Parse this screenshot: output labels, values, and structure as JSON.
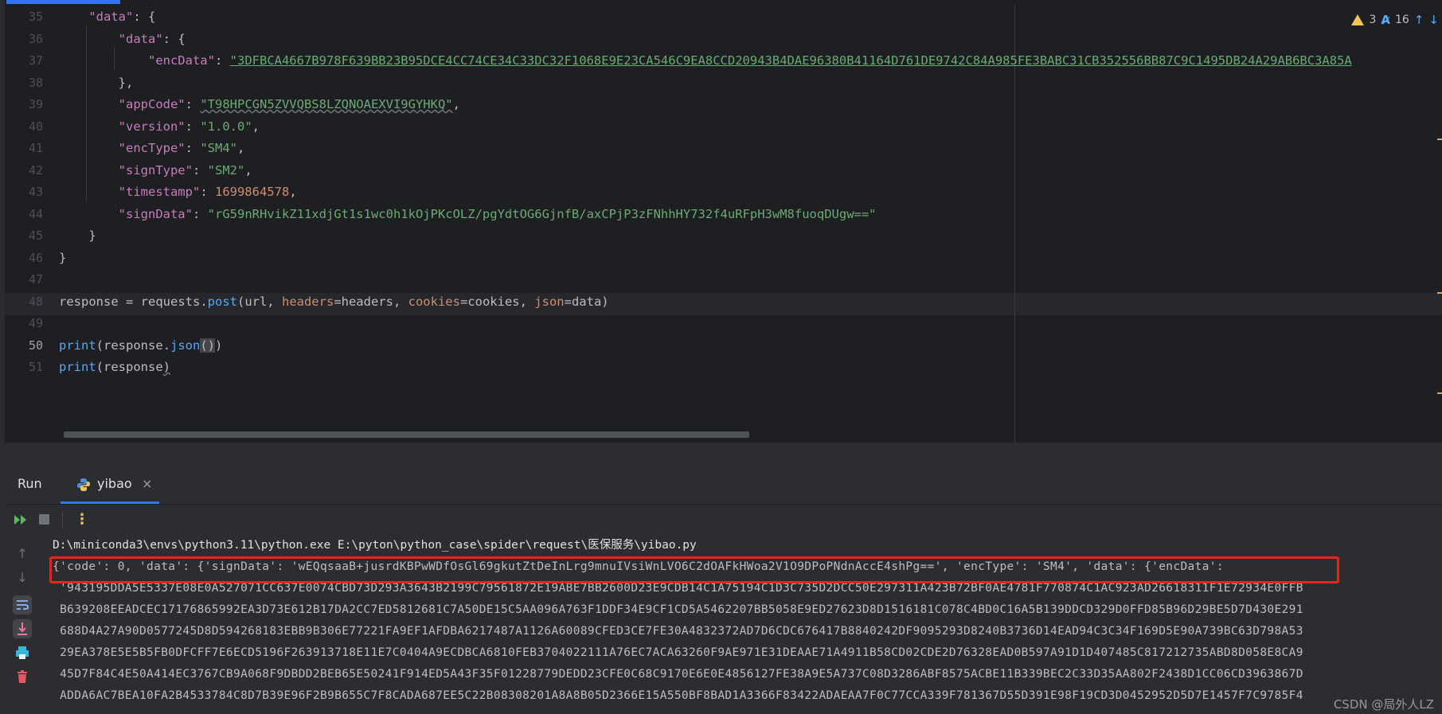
{
  "editor": {
    "line_numbers": [
      "35",
      "36",
      "37",
      "38",
      "39",
      "40",
      "41",
      "42",
      "43",
      "44",
      "45",
      "46",
      "47",
      "48",
      "49",
      "50",
      "51"
    ],
    "current_line": "50",
    "lines": {
      "l35": {
        "indent": "    ",
        "key": "\"data\"",
        "rest": ": {"
      },
      "l36": {
        "indent": "        ",
        "key": "\"data\"",
        "rest": ": {"
      },
      "l37": {
        "indent": "            ",
        "key": "\"encData\"",
        "colon": ": ",
        "value": "\"3DFBCA4667B978F639BB23B95DCE4CC74CE34C33DC32F1068E9E23CA546C9EA8CCD20943B4DAE96380B41164D761DE9742C84A985FE3BABC31CB352556BB87C9C1495DB24A29AB6BC3A85A"
      },
      "l38": {
        "indent": "        ",
        "text": "},"
      },
      "l39": {
        "indent": "        ",
        "key": "\"appCode\"",
        "colon": ": ",
        "value": "\"T98HPCGN5ZVVQBS8LZQNOAEXVI9GYHKQ\"",
        "tail": ","
      },
      "l40": {
        "indent": "        ",
        "key": "\"version\"",
        "colon": ": ",
        "value": "\"1.0.0\"",
        "tail": ","
      },
      "l41": {
        "indent": "        ",
        "key": "\"encType\"",
        "colon": ": ",
        "value": "\"SM4\"",
        "tail": ","
      },
      "l42": {
        "indent": "        ",
        "key": "\"signType\"",
        "colon": ": ",
        "value": "\"SM2\"",
        "tail": ","
      },
      "l43": {
        "indent": "        ",
        "key": "\"timestamp\"",
        "colon": ": ",
        "value": "1699864578",
        "tail": ","
      },
      "l44": {
        "indent": "        ",
        "key": "\"signData\"",
        "colon": ": ",
        "value": "\"rG59nRHvikZ11xdjGt1s1wc0h1kOjPKcOLZ/pgYdtOG6GjnfB/axCPjP3zFNhhHY732f4uRFpH3wM8fuoqDUgw==\""
      },
      "l45": {
        "indent": "    ",
        "text": "}"
      },
      "l46": {
        "indent": "",
        "text": "}"
      },
      "l48": {
        "var": "response",
        "eq": " = ",
        "obj": "requests",
        "dot": ".",
        "fn": "post",
        "p1": "(url, ",
        "kw1": "headers",
        "v1": "=headers, ",
        "kw2": "cookies",
        "v2": "=cookies, ",
        "kw3": "json",
        "v3": "=data)"
      },
      "l50": {
        "fn": "print",
        "open": "(response.",
        "method": "json",
        "parens": "()",
        "close": ")"
      },
      "l51": {
        "fn": "print",
        "text": "(response",
        "close": ")"
      }
    },
    "inspection": {
      "warnings": "3",
      "typos": "16",
      "up_arrow": "↑",
      "down_arrow": "↓"
    }
  },
  "run_panel": {
    "title": "Run",
    "tab_label": "yibao",
    "tab_close": "×",
    "more_icon": "⋮",
    "console": {
      "command": "D:\\miniconda3\\envs\\python3.11\\python.exe E:\\pyton\\python_case\\spider\\request\\医保服务\\yibao.py",
      "output_first": "{'code': 0, 'data': {'signData': 'wEQqsaaB+jusrdKBPwWDfOsGl69gkutZtDeInLrg9mnuIVsiWnLVO6C2dOAFkHWoa2V1O9DPoPNdnAccE4shPg==', 'encType': 'SM4', 'data': {'encData':",
      "output_lines": [
        " '943195DDA5E5337E08E0A527071CC637E0074CBD73D293A3643B2199C79561872E19ABE7BB2600D23E9CDB14C1A75194C1D3C735D2DCC50E297311A423B72BF0AE4781F770874C1AC923AD26618311F1E72934E0FFB",
        " B639208EEADCEC17176865992EA3D73E612B17DA2CC7ED5812681C7A50DE15C5AA096A763F1DDF34E9CF1CD5A5462207BB5058E9ED27623D8D1516181C078C4BD0C16A5B139DDCD329D0FFD85B96D29BE5D7D430E291",
        " 688D4A27A90D0577245D8D594268183EBB9B306E77221FA9EF1AFDBA6217487A1126A60089CFED3CE7FE30A4832372AD7D6CDC676417B8840242DF9095293D8240B3736D14EAD94C3C34F169D5E90A739BC63D798A53",
        " 29EA378E5E5B5FB0DFCFF7E6ECD5196F263913718E11E7C0404A9ECDBCA6810FEB3704022111A76EC7ACA63260F9AE971E31DEAAE71A4911B58CD02CDE2D76328EAD0B597A91D1D407485C817212735ABD8D058E8CA9",
        " 45D7F84C4E50A414EC3767CB9A068F9DBDD2BEB65E50241F914ED5A43F35F01228779DEDD23CFE0C68C9170E6E0E4856127FE38A9E5A737C08D3286ABF8575ACBE11B339BEC2C33D35AA802F2438D1CC06CD3963867D",
        " ADDA6AC7BEA10FA2B4533784C8D7B39E96F2B9B655C7F8CADA687EE5C22B08308201A8A8B05D2366E15A550BF8BAD1A3366F83422ADAEAA7F0C77CCA339F781367D55D391E98F19CD3D0452952D5D7E1457F7C9785F4"
      ]
    },
    "watermark": "CSDN @局外人LZ"
  },
  "colors": {
    "accent": "#3574f0",
    "highlight_box": "#e8251d",
    "string": "#6aab73",
    "number": "#2aacb8",
    "keyword_param": "#cf8e6d",
    "function": "#56a8f5"
  }
}
